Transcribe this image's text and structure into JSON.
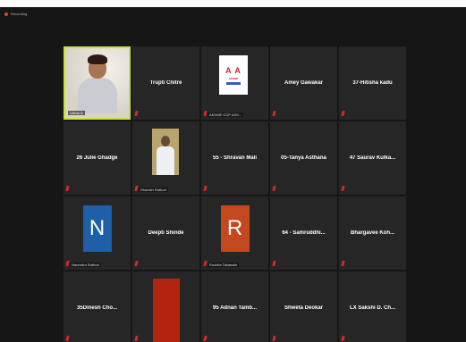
{
  "recording": {
    "label": "Recording",
    "color": "#e8442c"
  },
  "tiles": [
    {
      "kind": "video",
      "label": "Vishal N",
      "active": true
    },
    {
      "kind": "name",
      "name": "Trupti Chitre",
      "muted": true
    },
    {
      "kind": "logo",
      "logo_mark": "A A",
      "logo_text": "AEDME",
      "label": "AEDME COP ASS...",
      "muted": true
    },
    {
      "kind": "name",
      "name": "Amey Gawakar",
      "muted": true
    },
    {
      "kind": "name",
      "name": "37-Hitisha kadu",
      "muted": true
    },
    {
      "kind": "name",
      "name": "26 Julie Ghadge",
      "muted": true
    },
    {
      "kind": "photo",
      "label": "Dhanish Rathod",
      "muted": true
    },
    {
      "kind": "name",
      "name": "55 - Shravan Mali",
      "muted": true
    },
    {
      "kind": "name",
      "name": "05-Tanya Asthana",
      "muted": true
    },
    {
      "kind": "name",
      "name": "47 Saurav Kulka...",
      "muted": true
    },
    {
      "kind": "avatar",
      "letter": "N",
      "color": "#1f5fa8",
      "label": "Narendra Rathod",
      "muted": true
    },
    {
      "kind": "name",
      "name": "Deepti Shinde",
      "muted": true
    },
    {
      "kind": "avatar",
      "letter": "R",
      "color": "#c4481e",
      "label": "Ruchita Takawale",
      "muted": true
    },
    {
      "kind": "name",
      "name": "64 - Samruddhi...",
      "muted": true
    },
    {
      "kind": "name",
      "name": "Bhargavee Koh...",
      "muted": true
    },
    {
      "kind": "name",
      "name": "35Dinesh Cho...",
      "muted": true
    },
    {
      "kind": "redblock",
      "muted": true
    },
    {
      "kind": "name",
      "name": "95 Adnan Tamb...",
      "muted": true
    },
    {
      "kind": "name",
      "name": "Shweta Deokar",
      "muted": true
    },
    {
      "kind": "name",
      "name": "LX Sakshi D. Ch...",
      "muted": true
    }
  ]
}
